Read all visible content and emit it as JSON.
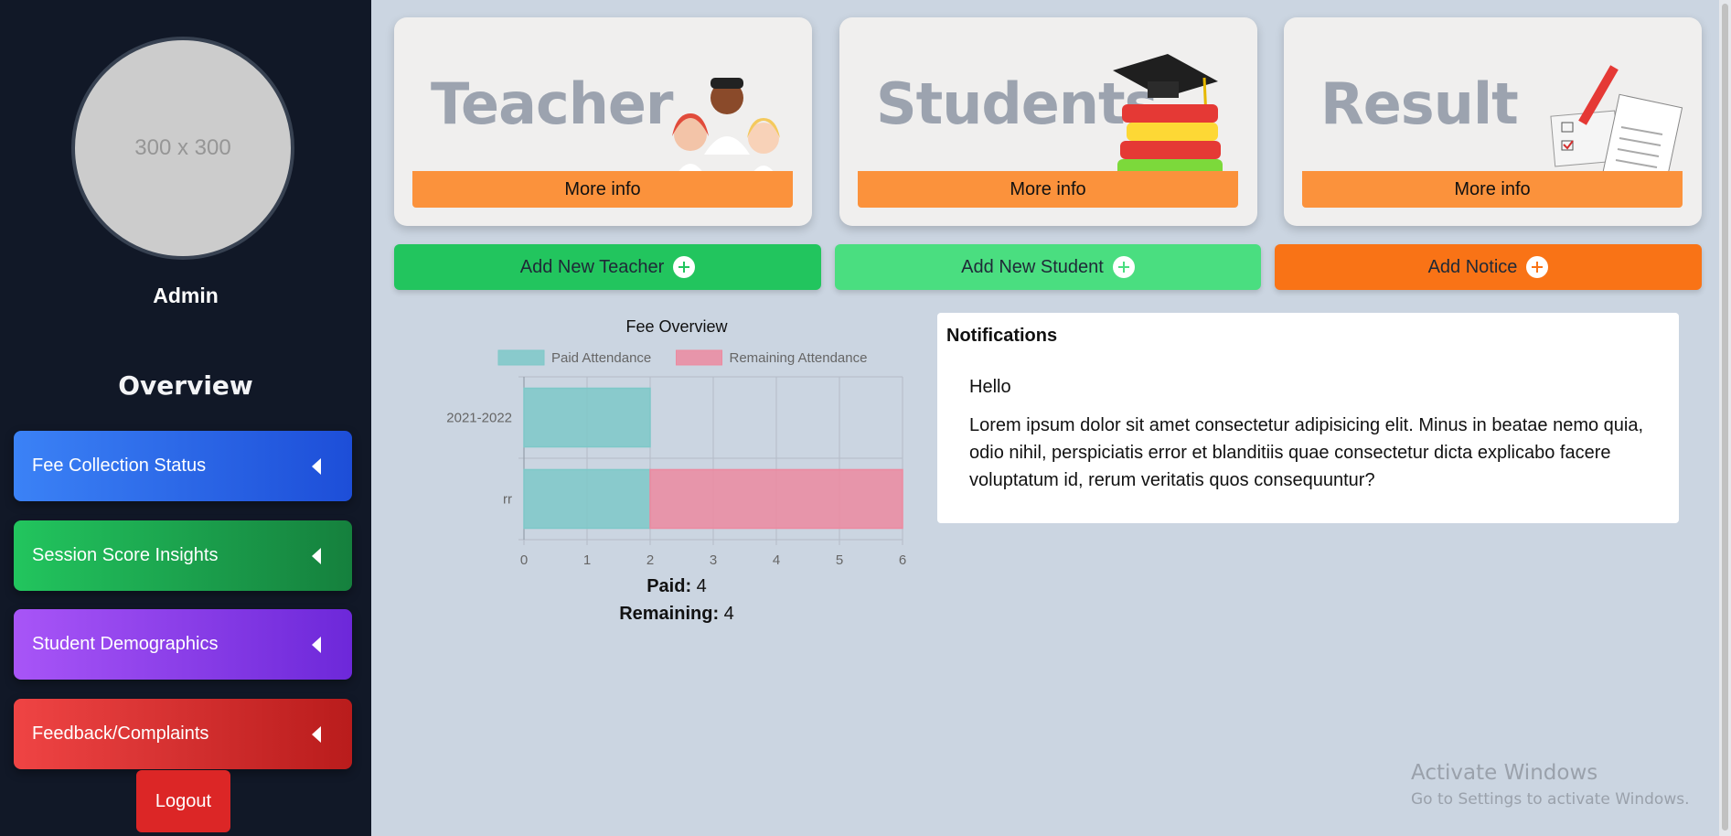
{
  "sidebar": {
    "avatar_placeholder": "300 x 300",
    "admin_name": "Admin",
    "section_title": "Overview",
    "items": [
      {
        "label": "Fee Collection Status",
        "color": "#2563eb"
      },
      {
        "label": "Session Score Insights",
        "color": "#16a34a"
      },
      {
        "label": "Student Demographics",
        "color": "#9333ea"
      },
      {
        "label": "Feedback/Complaints",
        "color": "#dc2626"
      }
    ],
    "logout_label": "Logout"
  },
  "cards": [
    {
      "title": "Teacher",
      "button": "More info",
      "icon": "people-icon"
    },
    {
      "title": "Students",
      "button": "More info",
      "icon": "graduation-books-icon"
    },
    {
      "title": "Result",
      "button": "More info",
      "icon": "report-pencil-icon"
    }
  ],
  "actions": [
    {
      "label": "Add New Teacher",
      "color": "#22c55e"
    },
    {
      "label": "Add New Student",
      "color": "#4ade80"
    },
    {
      "label": "Add Notice",
      "color": "#f97316"
    }
  ],
  "chart_data": {
    "type": "bar",
    "orientation": "horizontal",
    "stacked": true,
    "title": "Fee Overview",
    "categories": [
      "2021-2022",
      "rr"
    ],
    "series": [
      {
        "name": "Paid Attendance",
        "values": [
          2,
          2
        ],
        "color": "#7ec8c8"
      },
      {
        "name": "Remaining Attendance",
        "values": [
          0,
          4
        ],
        "color": "#ec8aa0"
      }
    ],
    "xlim": [
      0,
      6
    ],
    "xticks": [
      "0",
      "1",
      "2",
      "3",
      "4",
      "5",
      "6"
    ],
    "grid": true,
    "legend": "top"
  },
  "fee_summary": {
    "paid_label": "Paid:",
    "paid_value": "4",
    "remaining_label": "Remaining:",
    "remaining_value": "4"
  },
  "notifications": {
    "title": "Notifications",
    "heading": "Hello",
    "body": "Lorem ipsum dolor sit amet consectetur adipisicing elit. Minus in beatae nemo quia, odio nihil, perspiciatis error et blanditiis quae consectetur dicta explicabo facere voluptatum id, rerum veritatis quos consequuntur?"
  },
  "watermark": {
    "line1": "Activate Windows",
    "line2": "Go to Settings to activate Windows."
  }
}
